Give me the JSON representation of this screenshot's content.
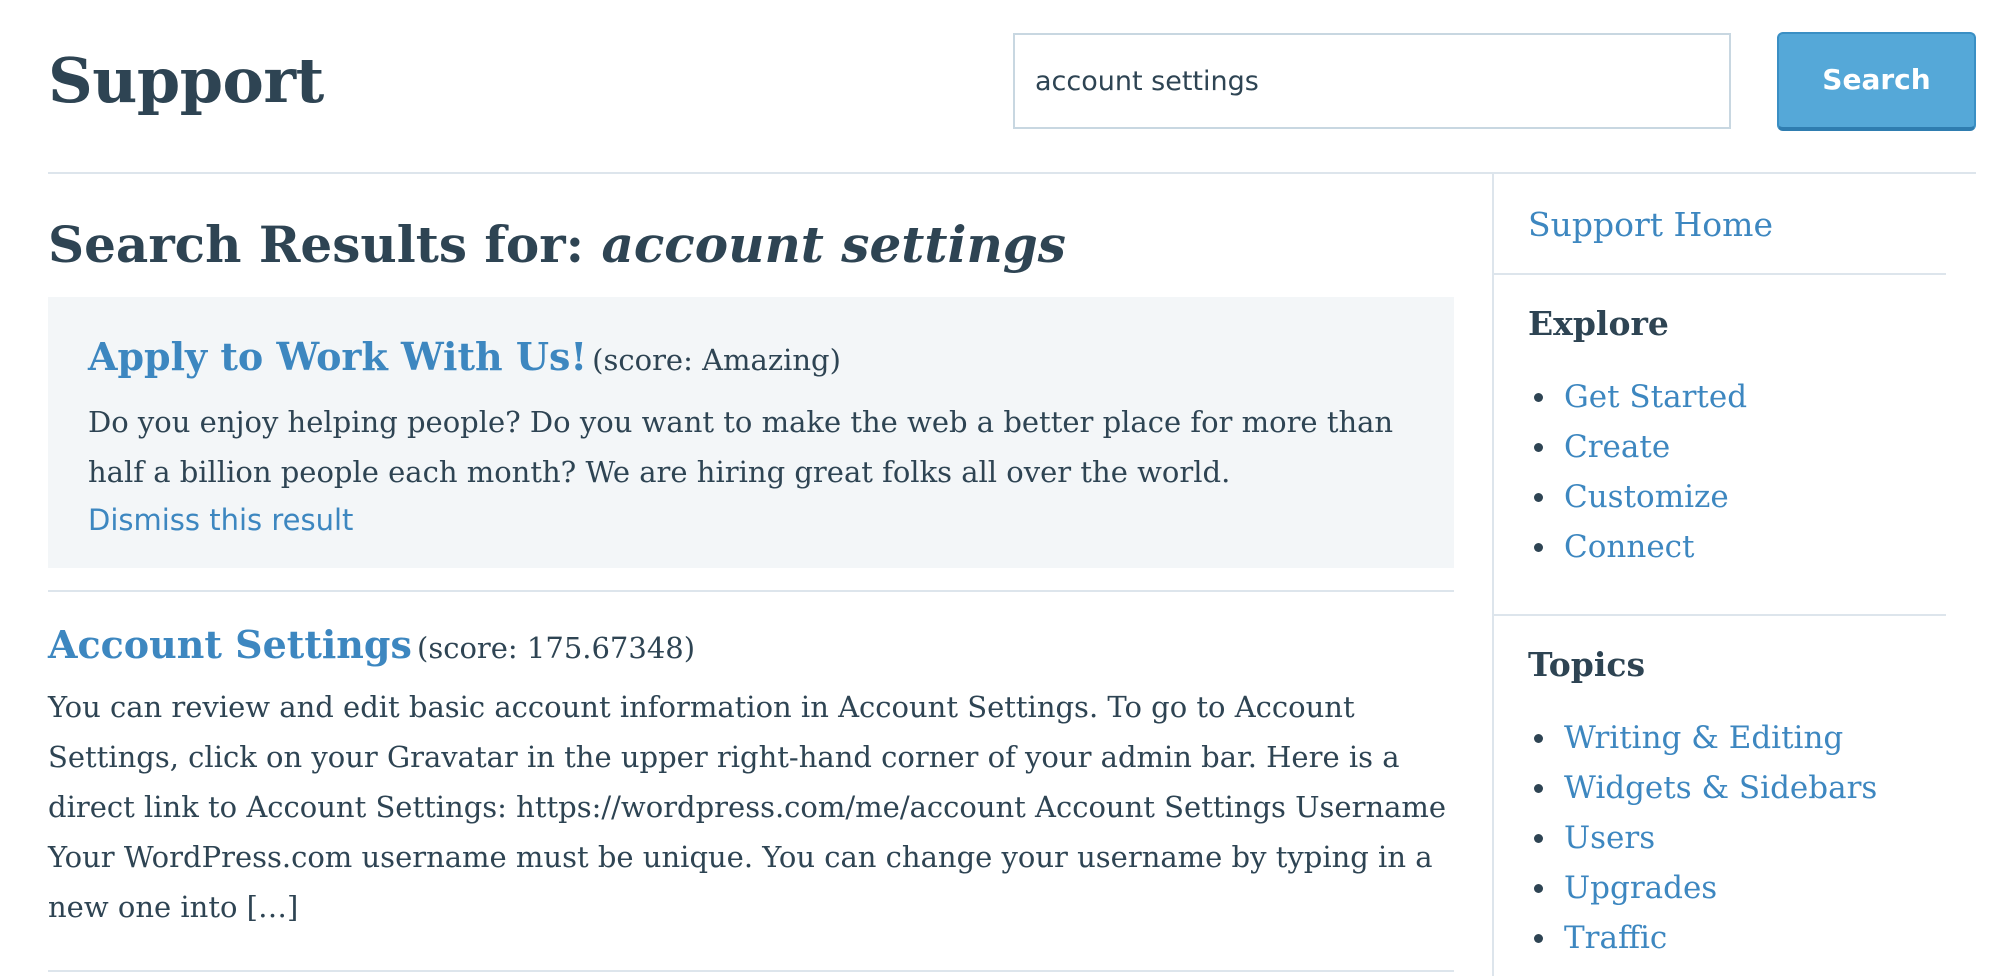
{
  "header": {
    "title": "Support",
    "search_value": "account settings",
    "search_button_label": "Search"
  },
  "main": {
    "heading_prefix": "Search Results for: ",
    "heading_query": "account settings",
    "featured_result": {
      "title": "Apply to Work With Us!",
      "score": "(score: Amazing)",
      "excerpt": "Do you enjoy helping people? Do you want to make the web a better place for more than half a billion people each month? We are hiring great folks all over the world.",
      "dismiss_label": "Dismiss this result"
    },
    "results": [
      {
        "title": "Account Settings",
        "score": "(score: 175.67348)",
        "excerpt": "You can review and edit basic account information in Account Settings. To go to Account Settings, click on your Gravatar in the upper right-hand corner of your admin bar. Here is a direct link to Account Settings: https://wordpress.com/me/account Account Settings Username Your WordPress.com username must be unique. You can change your username by typing in a new one into […]"
      }
    ]
  },
  "sidebar": {
    "home_link": "Support Home",
    "explore": {
      "heading": "Explore",
      "items": [
        "Get Started",
        "Create",
        "Customize",
        "Connect"
      ]
    },
    "topics": {
      "heading": "Topics",
      "items": [
        "Writing & Editing",
        "Widgets & Sidebars",
        "Users",
        "Upgrades",
        "Traffic"
      ]
    }
  },
  "colors": {
    "text": "#2e4453",
    "link": "#3d87c0",
    "button": "#55a8d8",
    "featured_bg": "#f3f6f8",
    "divider": "#dde5ec"
  }
}
